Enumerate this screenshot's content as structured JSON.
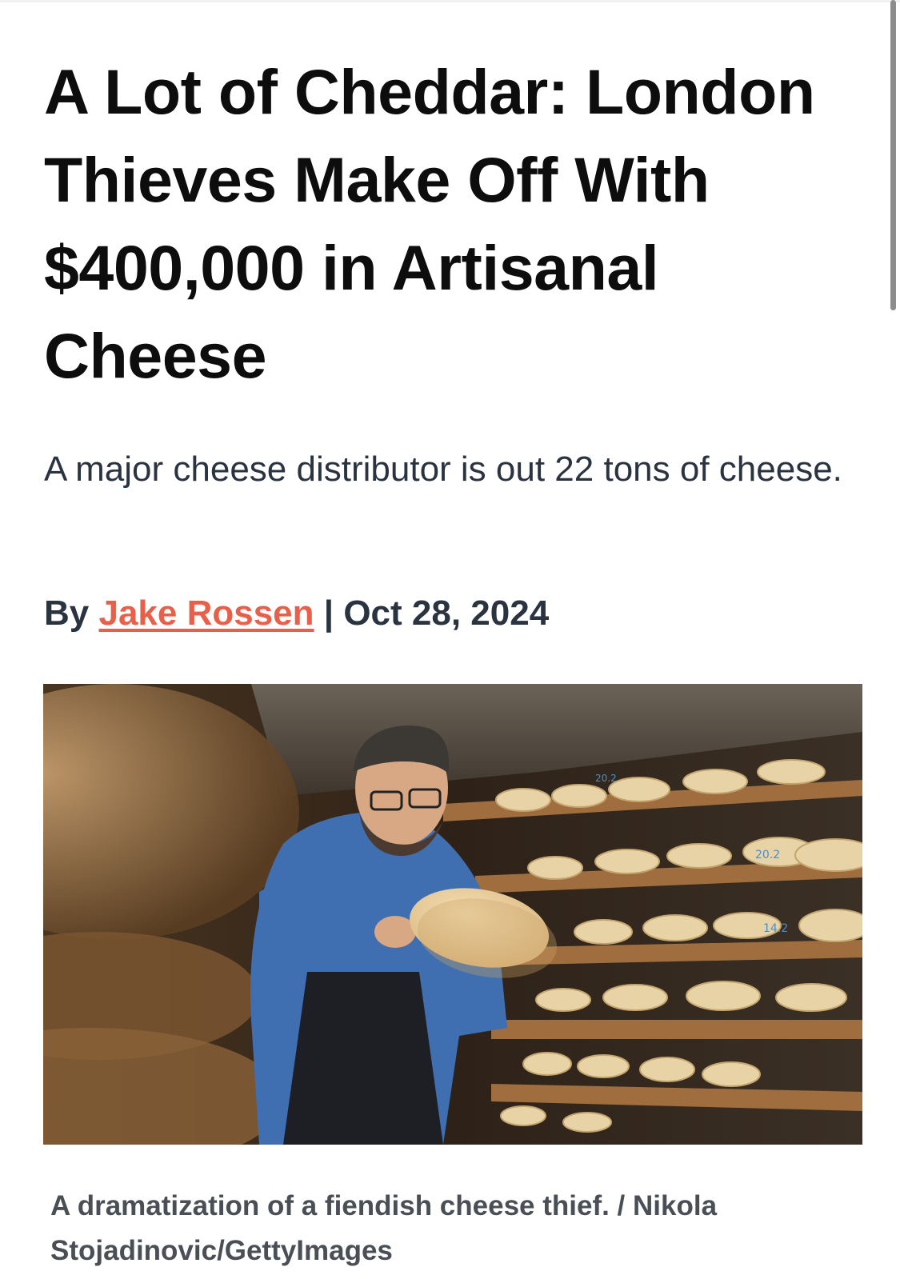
{
  "article": {
    "headline": "A Lot of Cheddar: London Thieves Make Off With $400,000 in Artisanal Cheese",
    "dek": "A major cheese distributor is out 22 tons of cheese.",
    "byline": {
      "prefix": "By",
      "author": "Jake Rossen",
      "separator": "|",
      "date": "Oct 28, 2024"
    },
    "image": {
      "shelf_labels": [
        "20.2",
        "20.2",
        "14.2"
      ]
    },
    "caption": "A dramatization of a fiendish cheese thief. / Nikola Stojadinovic/GettyImages"
  },
  "colors": {
    "headline": "#0d0d0d",
    "body": "#2a3340",
    "link": "#e8604a",
    "caption": "#4a4f55"
  }
}
